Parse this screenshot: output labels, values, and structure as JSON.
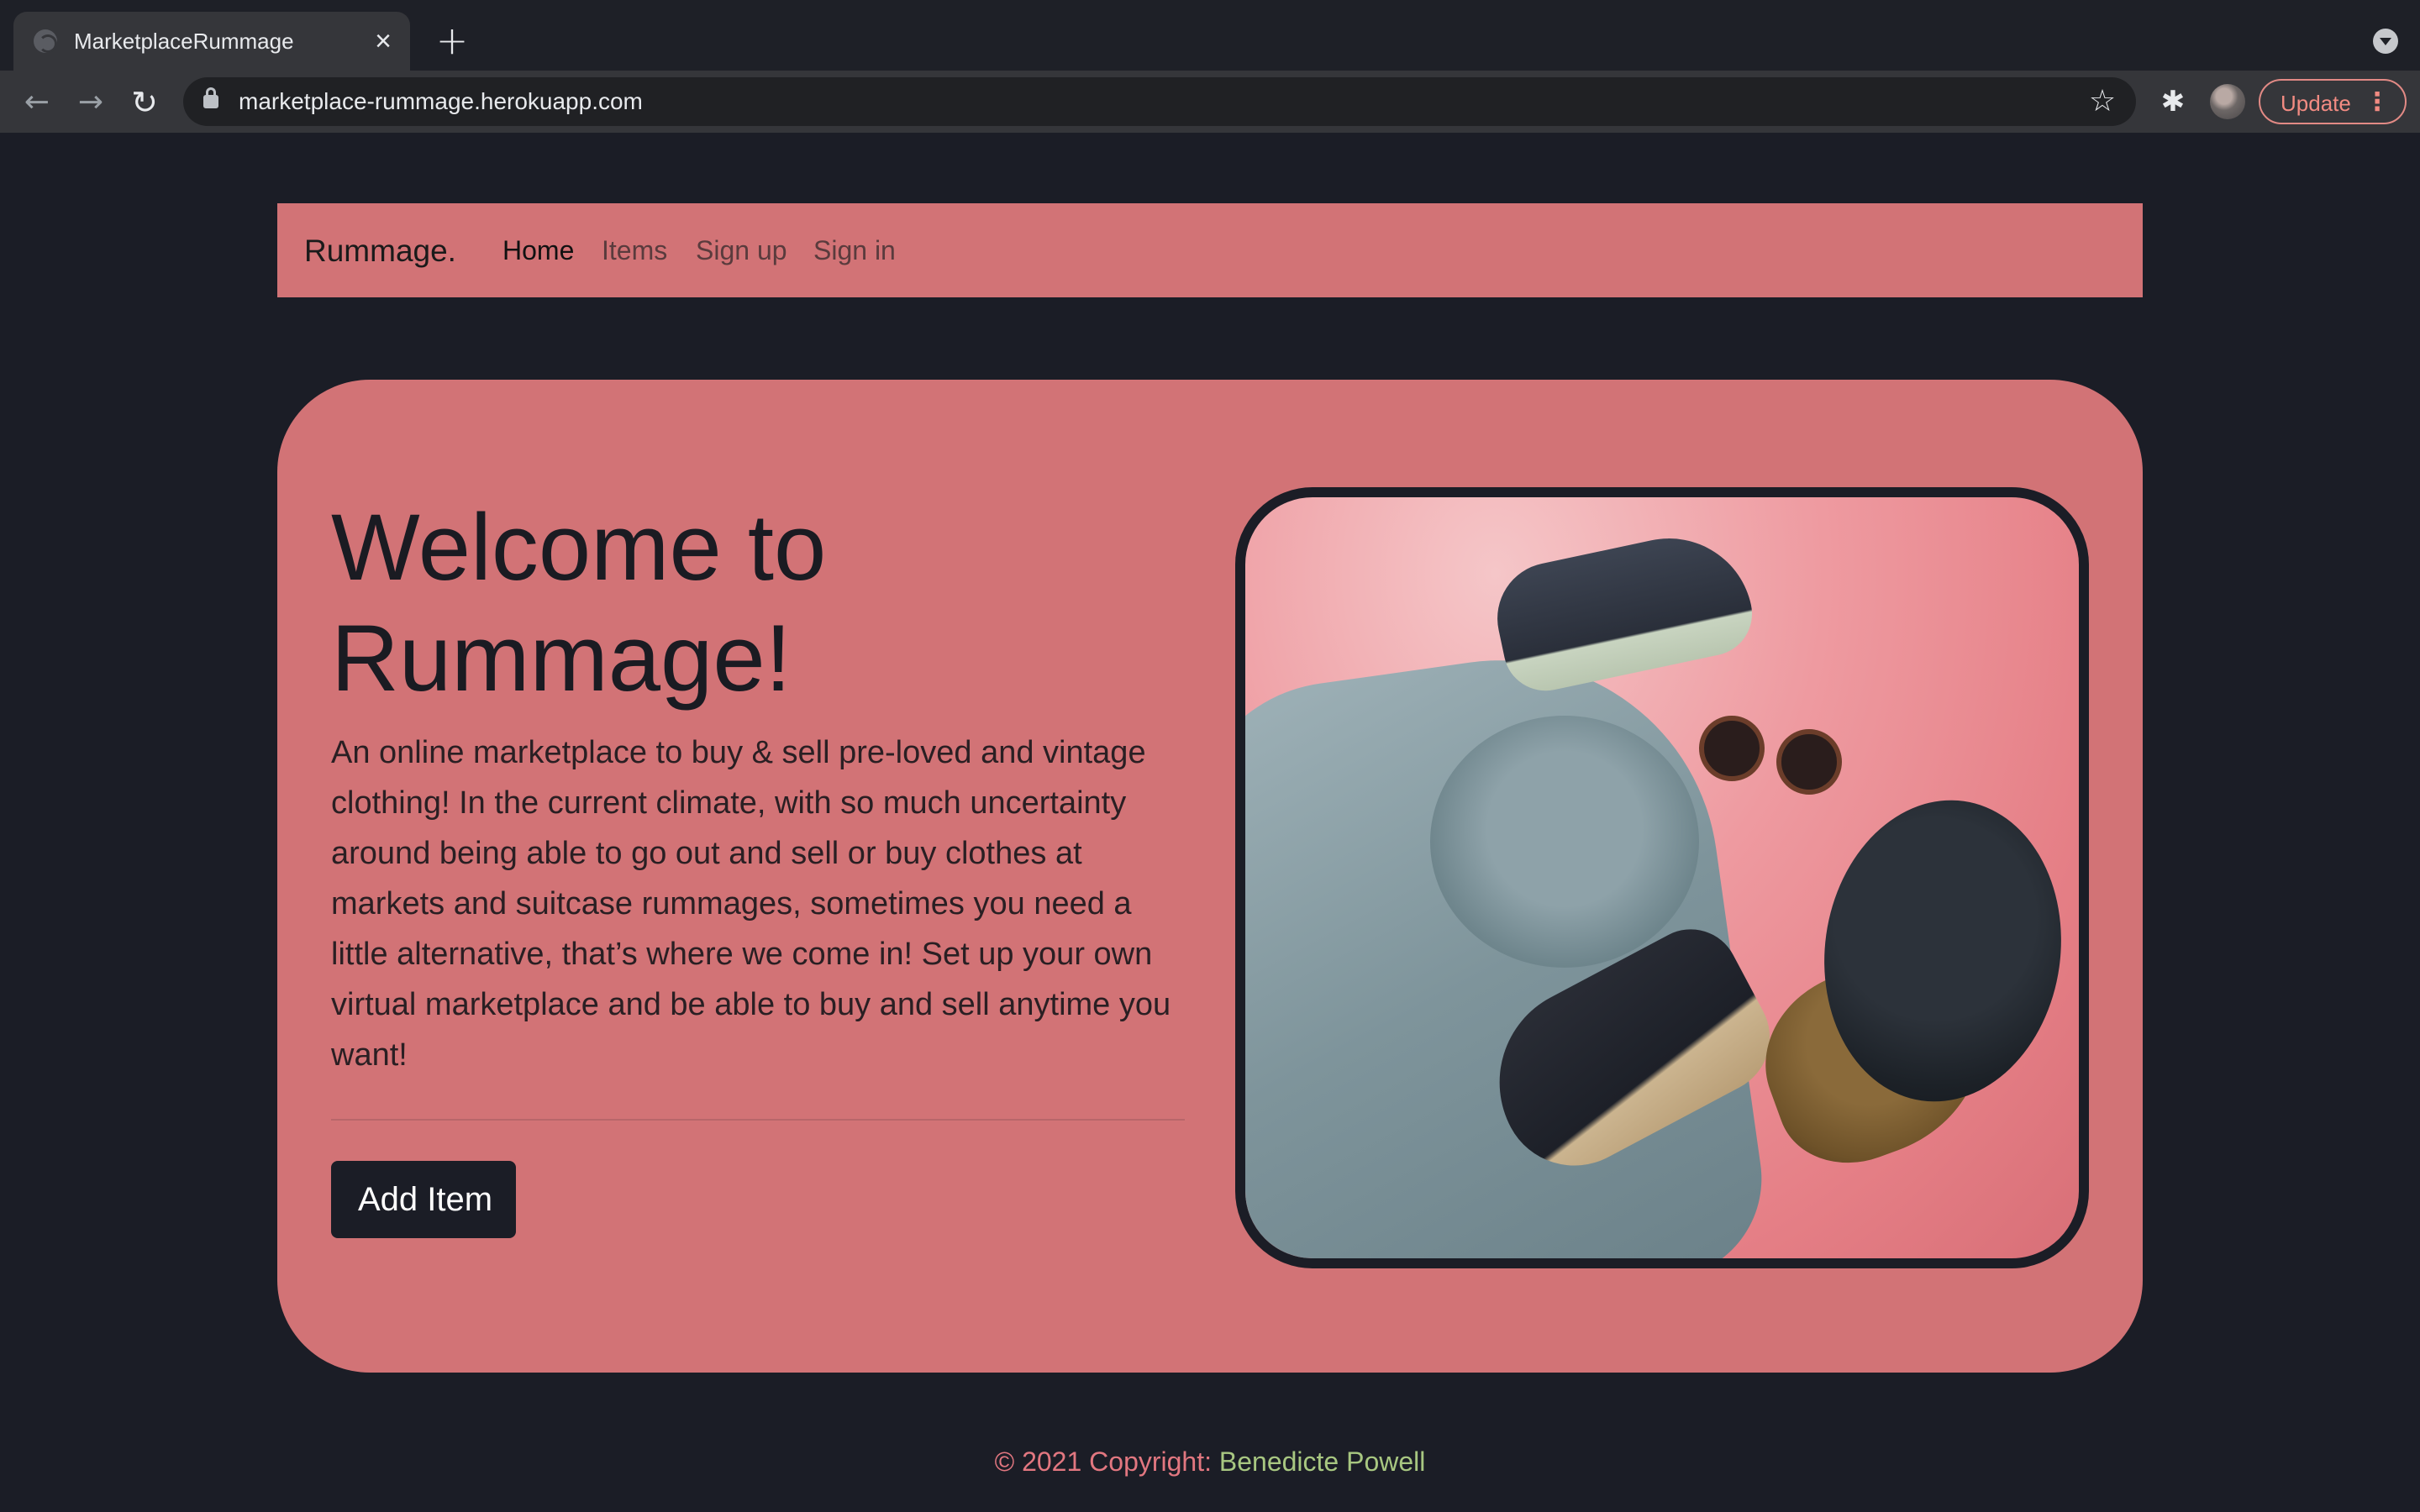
{
  "browser": {
    "tab_title": "MarketplaceRummage",
    "url": "marketplace-rummage.herokuapp.com",
    "update_label": "Update",
    "icons": {
      "back": "arrow-left-icon",
      "forward": "arrow-right-icon",
      "reload": "reload-icon",
      "lock": "lock-icon",
      "bookmark": "star-icon",
      "extensions": "puzzle-icon",
      "menu": "kebab-menu-icon"
    }
  },
  "navbar": {
    "brand": "Rummage.",
    "links": [
      "Home",
      "Items",
      "Sign up",
      "Sign in"
    ],
    "active": "Home"
  },
  "hero": {
    "title": "Welcome to Rummage!",
    "text": "An online marketplace to buy & sell pre-loved and vintage clothing!    In the current climate, with so much uncertainty around being able to go out and sell or buy clothes at markets and suitcase rummages, sometimes you need a little alternative, that’s where we come in!    Set up your own virtual marketplace and be able to buy and sell anytime you want!",
    "button_label": "Add Item"
  },
  "footer": {
    "prefix": "© 2021 Copyright: ",
    "author": "Benedicte Powell"
  },
  "colors": {
    "page_background": "#1b1d26",
    "brand_pink": "#d27376",
    "button_dark": "#1b1d26",
    "footer_text": "#e27780",
    "footer_link": "#a8c781"
  }
}
